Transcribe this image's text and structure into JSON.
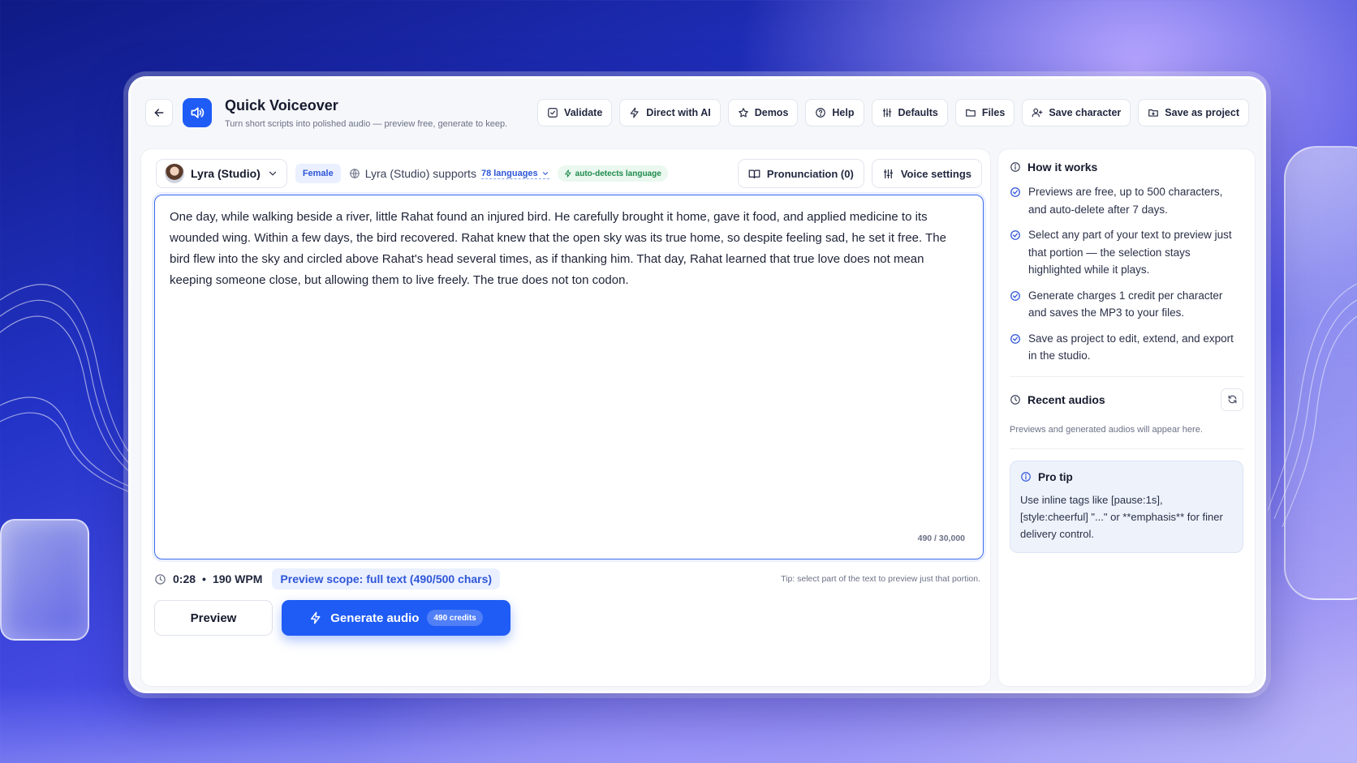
{
  "header": {
    "title": "Quick Voiceover",
    "subtitle": "Turn short scripts into polished audio — preview free, generate to keep.",
    "toolbar": [
      {
        "label": "Validate",
        "icon": "check-square-icon"
      },
      {
        "label": "Direct with AI",
        "icon": "bolt-icon"
      },
      {
        "label": "Demos",
        "icon": "star-icon"
      },
      {
        "label": "Help",
        "icon": "help-circle-icon"
      },
      {
        "label": "Defaults",
        "icon": "sliders-icon"
      },
      {
        "label": "Files",
        "icon": "folder-icon"
      },
      {
        "label": "Save character",
        "icon": "user-plus-icon"
      },
      {
        "label": "Save as project",
        "icon": "folder-save-icon"
      }
    ]
  },
  "voice": {
    "name": "Lyra (Studio)",
    "gender": "Female",
    "supports_text": "Lyra (Studio) supports",
    "languages_link": "78 languages",
    "auto_detect": "auto-detects language",
    "pronunciation_label": "Pronunciation (0)",
    "settings_label": "Voice settings"
  },
  "editor": {
    "text": "One day, while walking beside a river, little Rahat found an injured bird. He carefully brought it home, gave it food, and applied medicine to its wounded wing. Within a few days, the bird recovered. Rahat knew that the open sky was its true home, so despite feeling sad, he set it free. The bird flew into the sky and circled above Rahat's head several times, as if thanking him. That day, Rahat learned that true love does not mean keeping someone close, but allowing them to live freely. The true does not ton codon.",
    "char_count": "490 / 30,000"
  },
  "meta": {
    "duration": "0:28",
    "separator": "•",
    "wpm": "190 WPM",
    "scope": "Preview scope: full text (490/500 chars)",
    "tip": "Tip: select part of the text to preview just that portion."
  },
  "actions": {
    "preview_label": "Preview",
    "generate_label": "Generate audio",
    "credits": "490 credits"
  },
  "sidebar": {
    "how_title": "How it works",
    "steps": [
      "Previews are free, up to 500 characters, and auto-delete after 7 days.",
      "Select any part of your text to preview just that portion — the selection stays highlighted while it plays.",
      "Generate charges 1 credit per character and saves the MP3 to your files.",
      "Save as project to edit, extend, and export in the studio."
    ],
    "recent_title": "Recent audios",
    "recent_empty": "Previews and generated audios will appear here.",
    "tip_title": "Pro tip",
    "tip_body": "Use inline tags like [pause:1s], [style:cheerful] \"...\" or **emphasis** for finer delivery control."
  },
  "colors": {
    "accent": "#1f5cf5",
    "accent_soft": "#eaf0ff",
    "success": "#1f8a4c"
  }
}
